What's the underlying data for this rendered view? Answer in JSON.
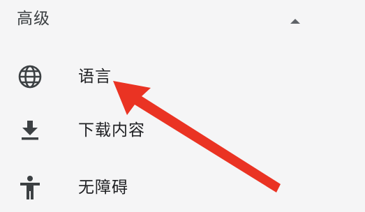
{
  "section": {
    "title": "高级",
    "toggle_icon": "chevron-up-icon"
  },
  "items": [
    {
      "label": "语言",
      "icon": "globe-icon"
    },
    {
      "label": "下载内容",
      "icon": "download-icon"
    },
    {
      "label": "无障碍",
      "icon": "accessibility-icon"
    }
  ],
  "colors": {
    "background": "#f5f5f6",
    "text": "#202124",
    "icon": "#3c4043",
    "annotation_arrow": "#ea3323"
  }
}
